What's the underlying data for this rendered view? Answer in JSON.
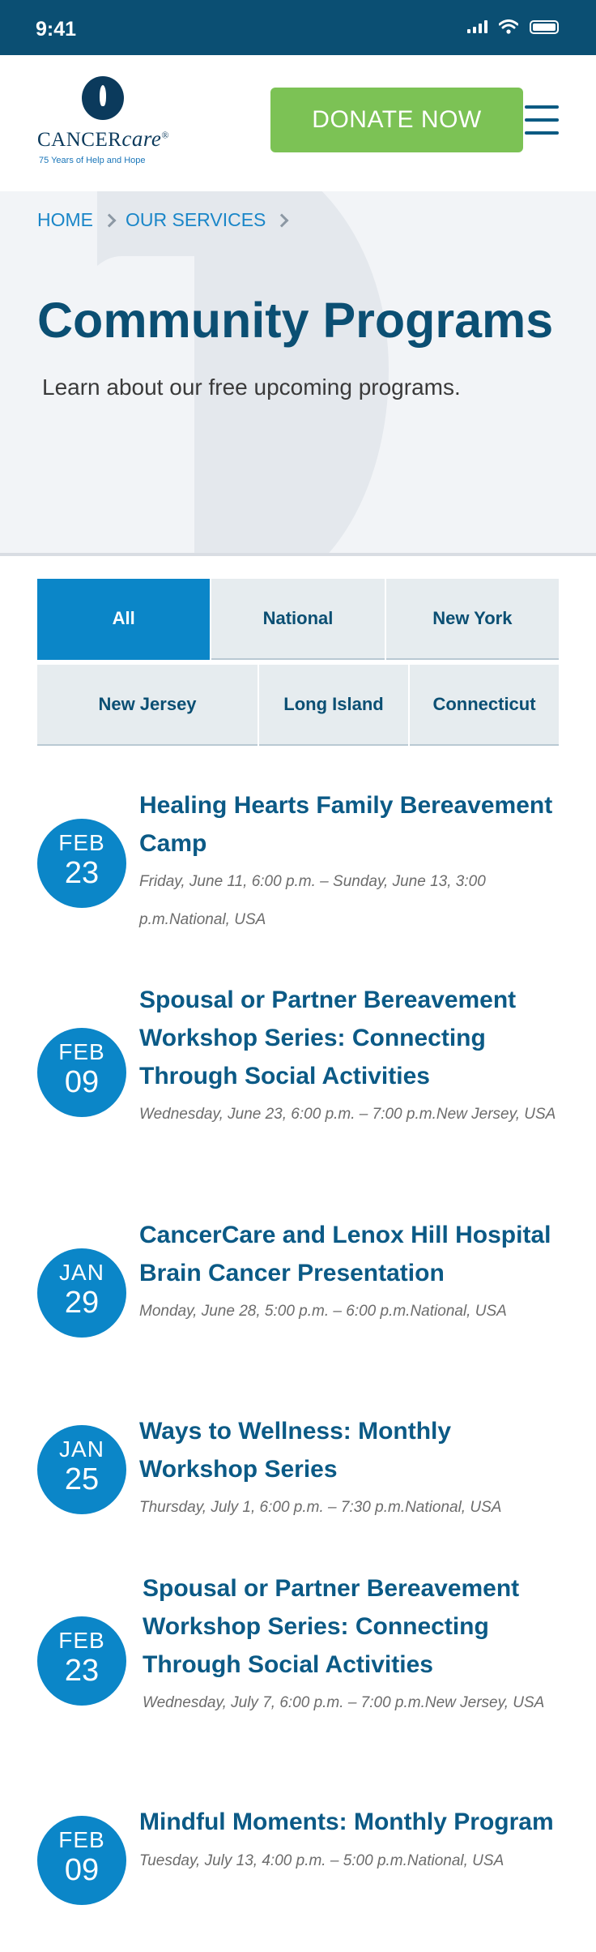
{
  "status_bar": {
    "time": "9:41"
  },
  "header": {
    "logo": {
      "word_cancer": "CANCER",
      "word_care": "care",
      "trademark": "®",
      "tagline": "75 Years of Help and Hope"
    },
    "donate_label": "DONATE NOW"
  },
  "breadcrumb": [
    {
      "label": "HOME"
    },
    {
      "label": "OUR SERVICES"
    }
  ],
  "hero": {
    "title": "Community Programs",
    "subtitle": "Learn about our free upcoming programs."
  },
  "filters": {
    "selected": "All",
    "tabs": [
      {
        "label": "All"
      },
      {
        "label": "National"
      },
      {
        "label": "New York"
      },
      {
        "label": "New Jersey"
      },
      {
        "label": "Long Island"
      },
      {
        "label": "Connecticut"
      }
    ]
  },
  "events": [
    {
      "month": "FEB",
      "day": "23",
      "title": "Healing Hearts Family Bereavement Camp",
      "details": "Friday, June 11, 6:00 p.m. – Sunday, June 13, 3:00 p.m.National, USA"
    },
    {
      "month": "FEB",
      "day": "09",
      "title": "Spousal or Partner Bereavement Workshop Series: Connecting Through Social Activities",
      "details": "Wednesday, June 23, 6:00 p.m. – 7:00 p.m.New Jersey, USA"
    },
    {
      "month": "JAN",
      "day": "29",
      "title": "CancerCare and Lenox Hill Hospital Brain Cancer Presentation",
      "details": "Monday, June 28, 5:00 p.m. – 6:00 p.m.National, USA"
    },
    {
      "month": "JAN",
      "day": "25",
      "title": "Ways to Wellness: Monthly Workshop Series",
      "details": "Thursday, July 1, 6:00 p.m. – 7:30 p.m.National, USA"
    },
    {
      "month": "FEB",
      "day": "23",
      "title": "Spousal or Partner Bereavement Workshop Series: Connecting Through Social Activities",
      "details": "Wednesday, July 7, 6:00 p.m. – 7:00 p.m.New Jersey, USA"
    },
    {
      "month": "FEB",
      "day": "09",
      "title": "Mindful Moments: Monthly Program",
      "details": "Tuesday, July 13, 4:00 p.m. – 5:00 p.m.National, USA"
    }
  ]
}
